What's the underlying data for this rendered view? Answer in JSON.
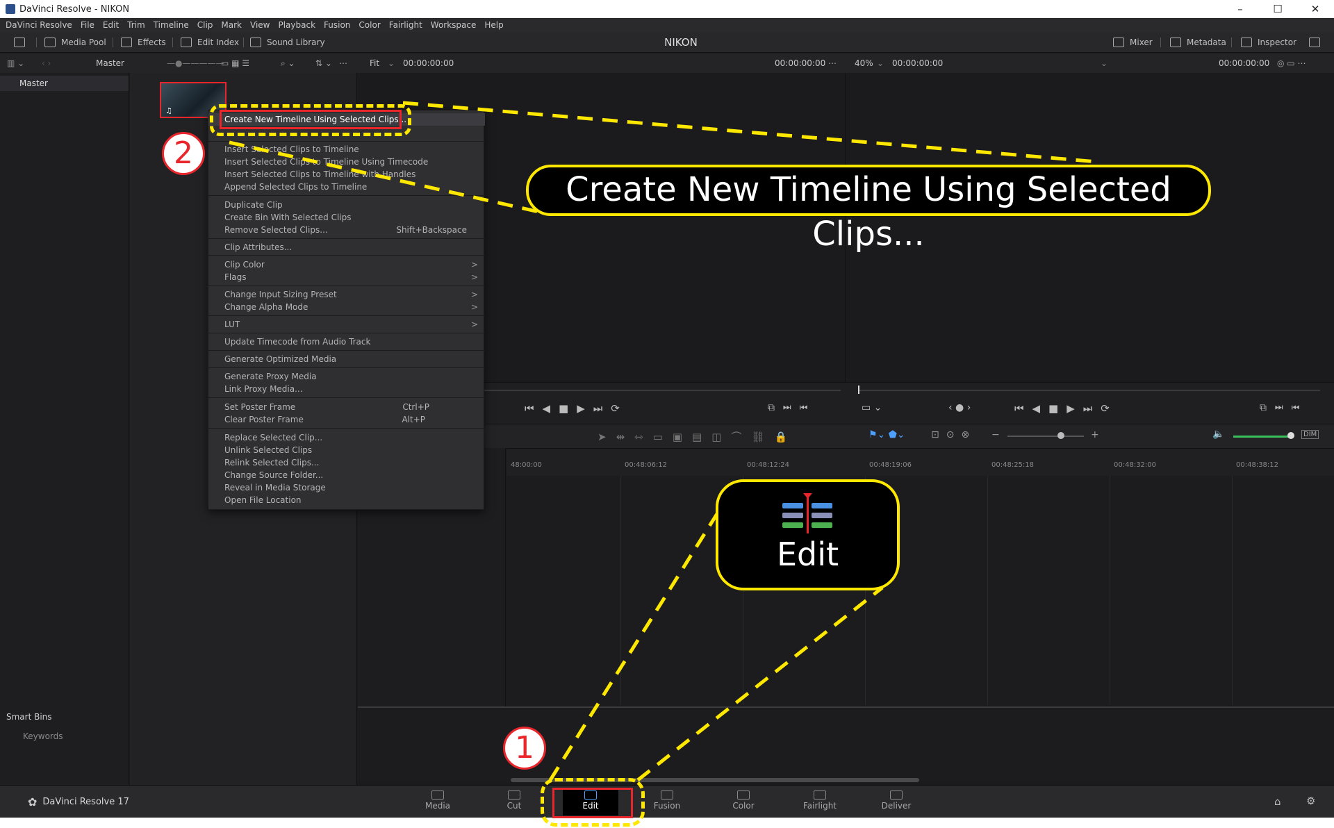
{
  "window": {
    "title": "DaVinci Resolve - NIKON",
    "controls": [
      "–",
      "☐",
      "✕"
    ]
  },
  "menu": [
    "DaVinci Resolve",
    "File",
    "Edit",
    "Trim",
    "Timeline",
    "Clip",
    "Mark",
    "View",
    "Playback",
    "Fusion",
    "Color",
    "Fairlight",
    "Workspace",
    "Help"
  ],
  "toolbar": {
    "media_pool": "Media Pool",
    "effects": "Effects",
    "edit_index": "Edit Index",
    "sound_library": "Sound Library",
    "project_name": "NIKON",
    "mixer": "Mixer",
    "metadata": "Metadata",
    "inspector": "Inspector"
  },
  "subbar": {
    "bin_name": "Master",
    "fit": "Fit",
    "src_tc_left": "00:00:00:00",
    "src_tc_right": "00:00:00:00",
    "zoom": "40%",
    "tl_tc_left": "00:00:00:00",
    "tl_tc_right": "00:00:00:00"
  },
  "bins": {
    "master": "Master",
    "smart_bins": "Smart Bins",
    "keywords": "Keywords"
  },
  "context_menu": {
    "create_timeline": "Create New Timeline Using Selected Clips...",
    "insert": "Insert Selected Clips to Timeline",
    "insert_tc": "Insert Selected Clips to Timeline Using Timecode",
    "insert_handles": "Insert Selected Clips to Timeline with Handles",
    "append": "Append Selected Clips to Timeline",
    "duplicate": "Duplicate Clip",
    "create_bin": "Create Bin With Selected Clips",
    "remove": "Remove Selected Clips...",
    "remove_sc": "Shift+Backspace",
    "attributes": "Clip Attributes...",
    "clip_color": "Clip Color",
    "flags": "Flags",
    "sizing": "Change Input Sizing Preset",
    "alpha": "Change Alpha Mode",
    "lut": "LUT",
    "update_tc": "Update Timecode from Audio Track",
    "optimized": "Generate Optimized Media",
    "proxy": "Generate Proxy Media",
    "link_proxy": "Link Proxy Media...",
    "set_poster": "Set Poster Frame",
    "set_poster_sc": "Ctrl+P",
    "clear_poster": "Clear Poster Frame",
    "clear_poster_sc": "Alt+P",
    "replace": "Replace Selected Clip...",
    "unlink": "Unlink Selected Clips",
    "relink": "Relink Selected Clips...",
    "source_folder": "Change Source Folder...",
    "reveal": "Reveal in Media Storage",
    "open_location": "Open File Location",
    "submenu_arrow": ">"
  },
  "ruler": [
    "48:00:00",
    "00:48:06:12",
    "00:48:12:24",
    "00:48:19:06",
    "00:48:25:18",
    "00:48:32:00",
    "00:48:38:12"
  ],
  "pages": {
    "brand": "DaVinci Resolve 17",
    "media": "Media",
    "cut": "Cut",
    "edit": "Edit",
    "fusion": "Fusion",
    "color": "Color",
    "fairlight": "Fairlight",
    "deliver": "Deliver"
  },
  "annotations": {
    "zoom_callout": "Create New Timeline Using Selected Clips...",
    "edit_callout": "Edit",
    "step1": "1",
    "step2": "2"
  },
  "colors": {
    "highlight_red": "#e8262b",
    "callout_yellow": "#ffe800",
    "accent_blue": "#4ea0ff"
  }
}
